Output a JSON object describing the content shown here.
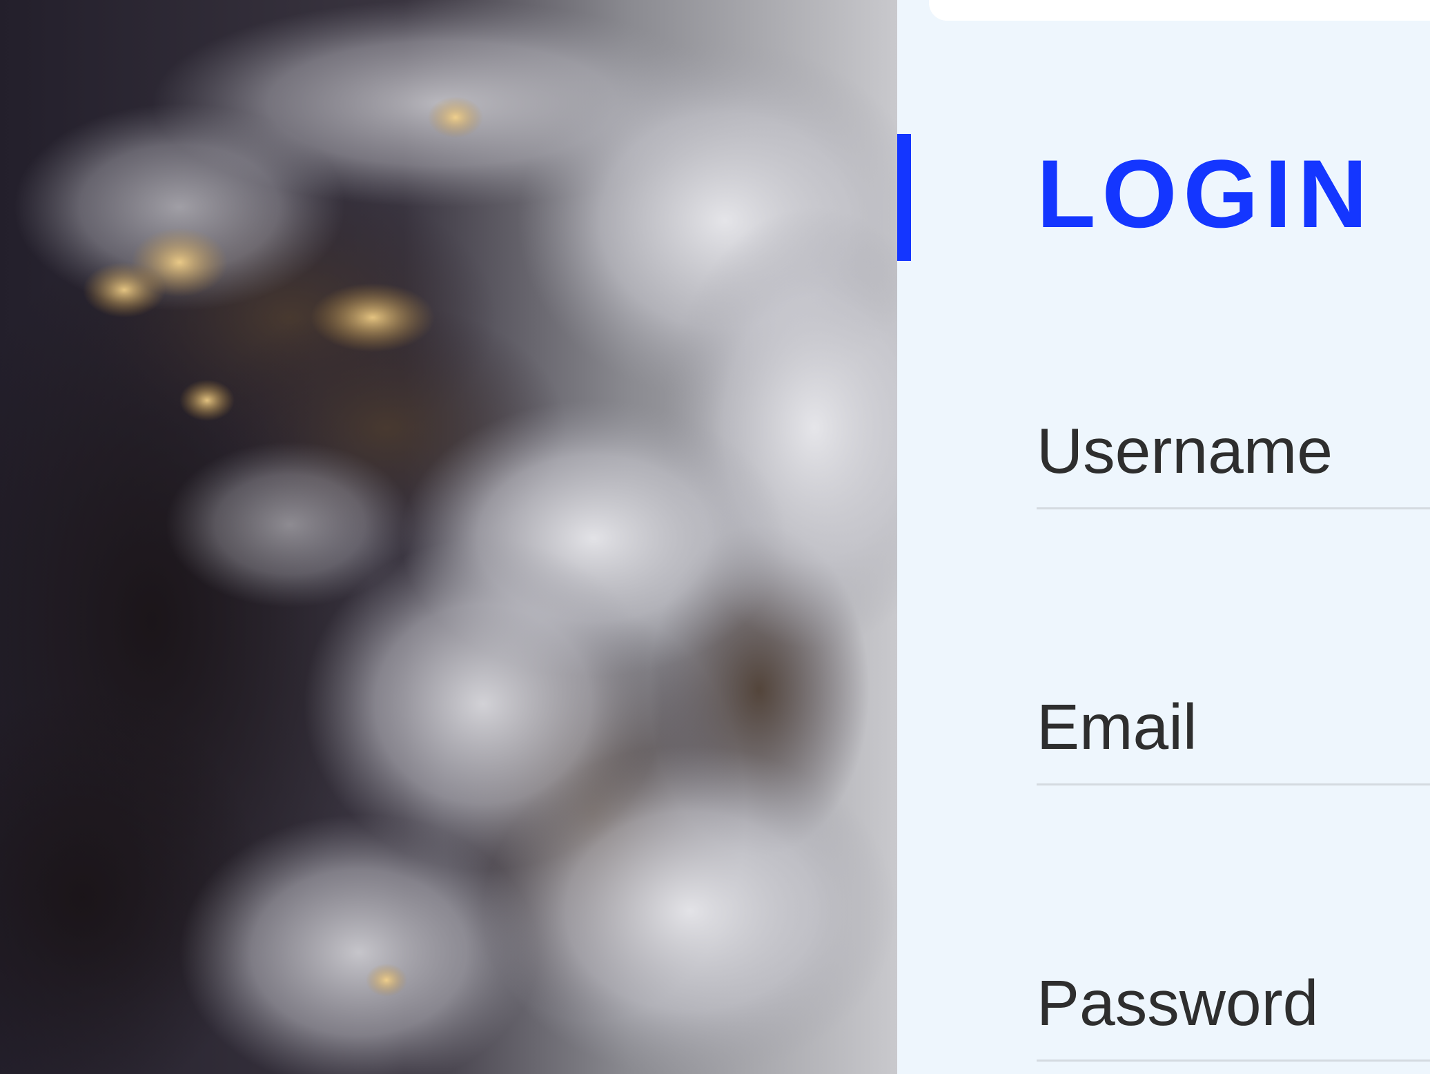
{
  "hero": {
    "image": "satellite-earth-clouds-night"
  },
  "login": {
    "title": "LOGIN",
    "accent_color": "#1436ff"
  },
  "form": {
    "username_label": "Username",
    "username_value": "",
    "email_label": "Email",
    "email_value": "",
    "password_label": "Password",
    "password_value": ""
  }
}
